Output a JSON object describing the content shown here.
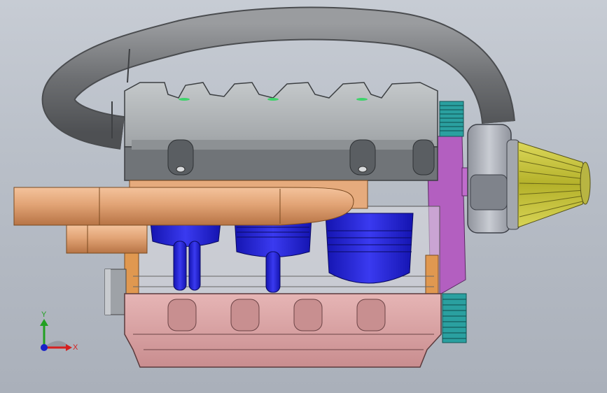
{
  "window": {
    "kind": "CAD 3D viewport",
    "background_top": "#c7ccd4",
    "background_bottom": "#aab0ba"
  },
  "triad": {
    "x_label": "X",
    "y_label": "Y",
    "x_color": "#d62020",
    "y_color": "#22a022",
    "z_color": "#1a22c8"
  },
  "parts": {
    "intake_hose": "#7d7f82",
    "cylinder_head": "#b2b6b8",
    "exhaust_pipes": "#e2a476",
    "pistons": "#2020d8",
    "oil_pan": "#d9a3a4",
    "timing_cover": "#b35fc0",
    "timing_gears": "#33c7c7",
    "air_filter": "#c9c63c",
    "turbo_housing": "#a7abb5",
    "engine_block": "#d9d9df"
  }
}
